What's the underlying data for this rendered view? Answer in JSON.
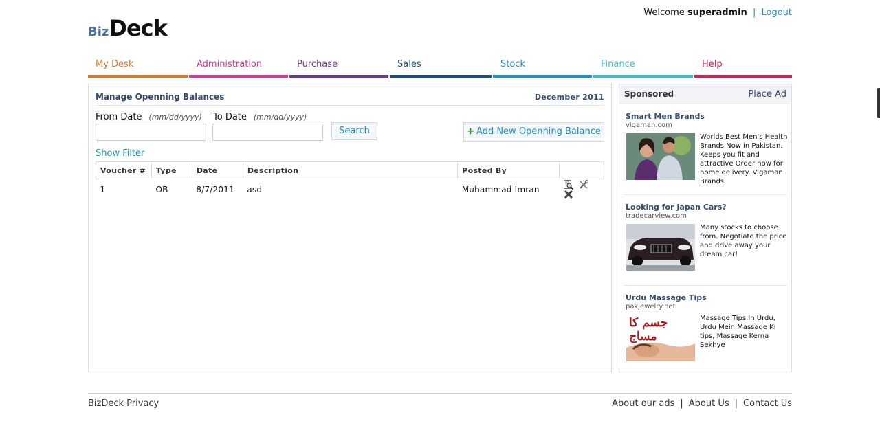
{
  "header": {
    "welcome_prefix": "Welcome",
    "username": "superadmin",
    "separator": "|",
    "logout": "Logout",
    "logo_biz": "Biz",
    "logo_deck": "Deck"
  },
  "nav": {
    "tabs": [
      {
        "label": "My Desk",
        "color": "#e0762b"
      },
      {
        "label": "Administration",
        "color": "#d6338c"
      },
      {
        "label": "Purchase",
        "color": "#6b3f8f"
      },
      {
        "label": "Sales",
        "color": "#1c4f8f"
      },
      {
        "label": "Stock",
        "color": "#1b8dc7"
      },
      {
        "label": "Finance",
        "color": "#3fbdd0"
      },
      {
        "label": "Help",
        "color": "#d42052"
      }
    ]
  },
  "main": {
    "title": "Manage Openning Balances",
    "month": "December 2011",
    "from_label": "From Date",
    "to_label": "To Date",
    "date_hint": "(mm/dd/yyyy)",
    "from_value": "",
    "to_value": "",
    "search_label": "Search",
    "add_plus": "+",
    "add_label": "Add New Openning Balance",
    "show_filter": "Show Filter",
    "columns": [
      "Voucher #",
      "Type",
      "Date",
      "Description",
      "Posted By",
      ""
    ],
    "rows": [
      {
        "voucher": "1",
        "type": "OB",
        "date": "8/7/2011",
        "description": "asd",
        "posted_by": "Muhammad Imran"
      }
    ],
    "row_actions": [
      "view-icon",
      "edit-icon",
      "delete-icon"
    ]
  },
  "sponsored": {
    "title": "Sponsored",
    "place_ad": "Place Ad",
    "ads": [
      {
        "headline": "Smart Men Brands",
        "url": "vigaman.com",
        "text": "Worlds Best Men's Health Brands Now in Pakistan. Keeps you fit and attractive Order now for home delivery. Vigaman Brands"
      },
      {
        "headline": "Looking for Japan Cars?",
        "url": "tradecarview.com",
        "text": "Many stocks to choose from. Negotiate the price and drive away your dream car!"
      },
      {
        "headline": "Urdu Massage Tips",
        "url": "pakjewelry.net",
        "text": "Massage Tips In Urdu, Urdu Mein Massage Ki tips, Massage Kerna Sekhye",
        "image_text": "جسم کا مساج"
      }
    ]
  },
  "footer": {
    "left": "BizDeck Privacy",
    "links": [
      "About our ads",
      "About Us",
      "Contact Us"
    ],
    "separator": "|"
  }
}
